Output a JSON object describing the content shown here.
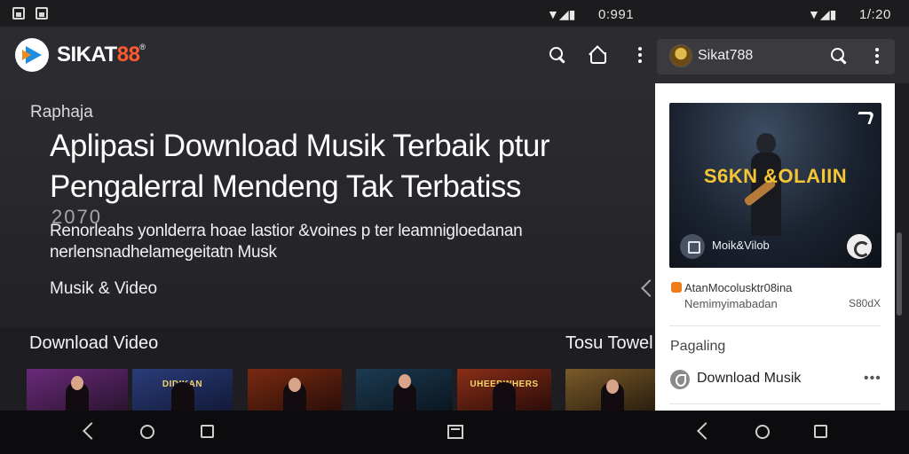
{
  "status_bar": {
    "clock_left": "0:991",
    "clock_right": "1/:20"
  },
  "app_bar": {
    "brand_main": "SIKAT",
    "brand_accent": "88",
    "brand_mark": "®",
    "colors": {
      "accent": "#ff5a2c",
      "logo_blue": "#1e8de0",
      "logo_orange": "#f28b1c"
    }
  },
  "side_panel": {
    "user_name": "Sikat788",
    "card": {
      "title": "S6KN &OLAIIN",
      "chip_label": "Moik&Vilob"
    },
    "info": {
      "title": "AtanMocolusktr08ina",
      "subtitle": "Nemimyimabadan",
      "size": "S80dX"
    },
    "list_heading": "Pagaling",
    "list_item": "Download Musik",
    "list_more": "•••"
  },
  "hero": {
    "kicker": "Raphaja",
    "headline": "Aplipasi Download Musik Terbaik ptur Pengalerral Mendeng Tak Terbatiss",
    "year": "2070",
    "description": "Renorleahs yonlderra hoae lastior &voines p ter leamnigloedanan nerlensnadhelamegeitatn Musk",
    "category": "Musik & Video"
  },
  "sections": {
    "left_title": "Download Video",
    "right_title": "Tosu Towel"
  },
  "thumbnails": [
    {
      "label": "",
      "colors": [
        "#6a2a7a",
        "#2a1430"
      ]
    },
    {
      "label": "DIDIKAN",
      "colors": [
        "#2a3c7a",
        "#121a38"
      ]
    },
    {
      "label": "",
      "colors": [
        "#7a2a12",
        "#2a0e08"
      ]
    },
    {
      "label": "",
      "colors": [
        "#1c3a52",
        "#0a1620"
      ]
    },
    {
      "label": "UHEEBWHERS",
      "colors": [
        "#8a2e18",
        "#2a0c08"
      ]
    },
    {
      "label": "",
      "colors": [
        "#7a5a2a",
        "#2a1e0e"
      ]
    }
  ]
}
